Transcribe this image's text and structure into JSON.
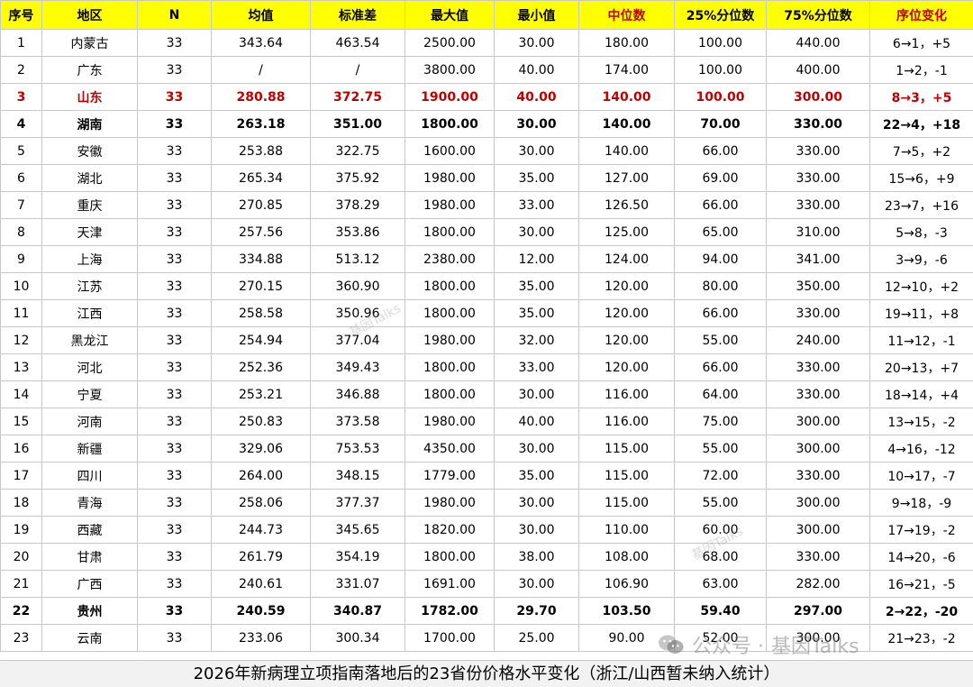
{
  "table": {
    "headers": [
      "序号",
      "地区",
      "N",
      "均值",
      "标准差",
      "最大值",
      "最小值",
      "中位数",
      "25%分位数",
      "75%分位数",
      "序位变化"
    ],
    "highlight_header_indices": [
      7,
      10
    ],
    "highlight_color": "#c00000",
    "header_bg": "#ffff00",
    "rows": [
      {
        "style": "normal",
        "cells": [
          "1",
          "内蒙古",
          "33",
          "343.64",
          "463.54",
          "2500.00",
          "30.00",
          "180.00",
          "100.00",
          "440.00",
          "6→1，+5"
        ]
      },
      {
        "style": "normal",
        "cells": [
          "2",
          "广东",
          "33",
          "/",
          "/",
          "3800.00",
          "40.00",
          "174.00",
          "100.00",
          "400.00",
          "1→2，-1"
        ]
      },
      {
        "style": "highlight",
        "cells": [
          "3",
          "山东",
          "33",
          "280.88",
          "372.75",
          "1900.00",
          "40.00",
          "140.00",
          "100.00",
          "300.00",
          "8→3，+5"
        ]
      },
      {
        "style": "bold",
        "cells": [
          "4",
          "湖南",
          "33",
          "263.18",
          "351.00",
          "1800.00",
          "30.00",
          "140.00",
          "70.00",
          "330.00",
          "22→4，+18"
        ]
      },
      {
        "style": "normal",
        "cells": [
          "5",
          "安徽",
          "33",
          "253.88",
          "322.75",
          "1600.00",
          "30.00",
          "140.00",
          "66.00",
          "330.00",
          "7→5，+2"
        ]
      },
      {
        "style": "normal",
        "cells": [
          "6",
          "湖北",
          "33",
          "265.34",
          "375.92",
          "1980.00",
          "35.00",
          "127.00",
          "69.00",
          "330.00",
          "15→6，+9"
        ]
      },
      {
        "style": "normal",
        "cells": [
          "7",
          "重庆",
          "33",
          "270.85",
          "378.29",
          "1980.00",
          "33.00",
          "126.50",
          "66.00",
          "330.00",
          "23→7，+16"
        ]
      },
      {
        "style": "normal",
        "cells": [
          "8",
          "天津",
          "33",
          "257.56",
          "353.86",
          "1800.00",
          "30.00",
          "125.00",
          "65.00",
          "310.00",
          "5→8，-3"
        ]
      },
      {
        "style": "normal",
        "cells": [
          "9",
          "上海",
          "33",
          "334.88",
          "513.12",
          "2380.00",
          "12.00",
          "124.00",
          "94.00",
          "341.00",
          "3→9，-6"
        ]
      },
      {
        "style": "normal",
        "cells": [
          "10",
          "江苏",
          "33",
          "270.15",
          "360.90",
          "1800.00",
          "35.00",
          "120.00",
          "80.00",
          "350.00",
          "12→10，+2"
        ]
      },
      {
        "style": "normal",
        "cells": [
          "11",
          "江西",
          "33",
          "258.58",
          "350.96",
          "1800.00",
          "35.00",
          "120.00",
          "66.00",
          "330.00",
          "19→11，+8"
        ]
      },
      {
        "style": "normal",
        "cells": [
          "12",
          "黑龙江",
          "33",
          "254.94",
          "377.04",
          "1980.00",
          "32.00",
          "120.00",
          "55.00",
          "240.00",
          "11→12，-1"
        ]
      },
      {
        "style": "normal",
        "cells": [
          "13",
          "河北",
          "33",
          "252.36",
          "349.43",
          "1800.00",
          "33.00",
          "120.00",
          "66.00",
          "330.00",
          "20→13，+7"
        ]
      },
      {
        "style": "normal",
        "cells": [
          "14",
          "宁夏",
          "33",
          "253.21",
          "346.88",
          "1800.00",
          "30.00",
          "116.00",
          "64.00",
          "330.00",
          "18→14，+4"
        ]
      },
      {
        "style": "normal",
        "cells": [
          "15",
          "河南",
          "33",
          "250.83",
          "373.58",
          "1980.00",
          "40.00",
          "116.00",
          "75.00",
          "300.00",
          "13→15，-2"
        ]
      },
      {
        "style": "normal",
        "cells": [
          "16",
          "新疆",
          "33",
          "329.06",
          "753.53",
          "4350.00",
          "30.00",
          "115.00",
          "55.00",
          "300.00",
          "4→16，-12"
        ]
      },
      {
        "style": "normal",
        "cells": [
          "17",
          "四川",
          "33",
          "264.00",
          "348.15",
          "1779.00",
          "35.00",
          "115.00",
          "72.00",
          "330.00",
          "10→17，-7"
        ]
      },
      {
        "style": "normal",
        "cells": [
          "18",
          "青海",
          "33",
          "258.06",
          "377.37",
          "1980.00",
          "30.00",
          "115.00",
          "55.00",
          "300.00",
          "9→18，-9"
        ]
      },
      {
        "style": "normal",
        "cells": [
          "19",
          "西藏",
          "33",
          "244.73",
          "345.65",
          "1820.00",
          "30.00",
          "110.00",
          "60.00",
          "300.00",
          "17→19，-2"
        ]
      },
      {
        "style": "normal",
        "cells": [
          "20",
          "甘肃",
          "33",
          "261.79",
          "354.19",
          "1800.00",
          "38.00",
          "108.00",
          "68.00",
          "330.00",
          "14→20，-6"
        ]
      },
      {
        "style": "normal",
        "cells": [
          "21",
          "广西",
          "33",
          "240.61",
          "331.07",
          "1691.00",
          "30.00",
          "106.90",
          "63.00",
          "282.00",
          "16→21，-5"
        ]
      },
      {
        "style": "bold",
        "cells": [
          "22",
          "贵州",
          "33",
          "240.59",
          "340.87",
          "1782.00",
          "29.70",
          "103.50",
          "59.40",
          "297.00",
          "2→22，-20"
        ]
      },
      {
        "style": "normal",
        "cells": [
          "23",
          "云南",
          "33",
          "233.06",
          "300.34",
          "1700.00",
          "25.00",
          "90.00",
          "52.00",
          "300.00",
          "21→23，-2"
        ]
      }
    ]
  },
  "caption": "2026年新病理立项指南落地后的23省份价格水平变化（浙江/山西暂未纳入统计）",
  "watermark": {
    "small": "基因Talks",
    "prefix": "公众号 ·",
    "brand": "基因Talks"
  }
}
